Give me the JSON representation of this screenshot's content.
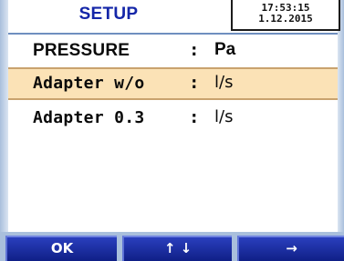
{
  "header": {
    "title": "SETUP",
    "time": "17:53:15",
    "date": "1.12.2015"
  },
  "rows": [
    {
      "label": "PRESSURE",
      "colon": ":",
      "unit": "Pa",
      "selected": false
    },
    {
      "label": "Adapter w/o",
      "colon": ":",
      "unit": "l/s",
      "selected": true
    },
    {
      "label": "Adapter 0.3",
      "colon": ":",
      "unit": "l/s",
      "selected": false
    }
  ],
  "softkeys": {
    "ok_label": "OK",
    "updown_label": "↑ ↓",
    "right_label": "→"
  },
  "colors": {
    "title": "#1426a8",
    "selected_row": "#fbe2b6",
    "softkey": "#1a2da4",
    "rail": "#a9bfdc"
  }
}
